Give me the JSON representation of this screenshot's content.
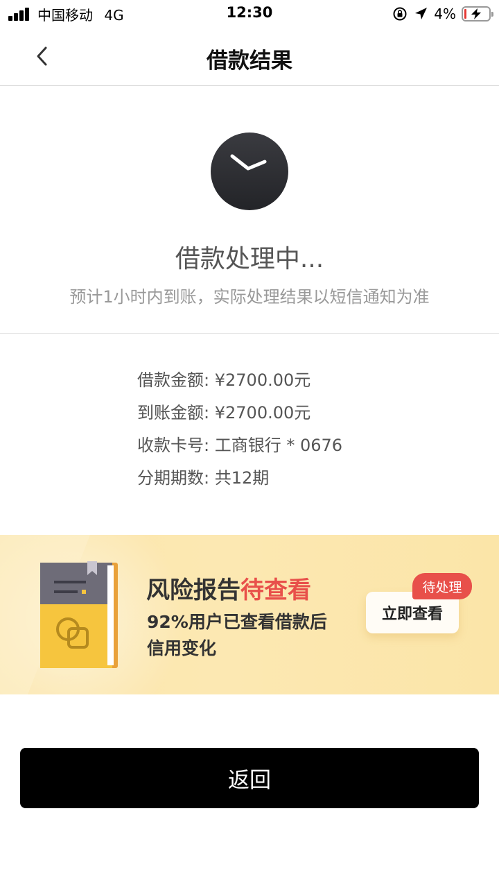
{
  "status_bar": {
    "carrier": "中国移动",
    "network": "4G",
    "time": "12:30",
    "battery_percent": "4%"
  },
  "nav": {
    "title": "借款结果"
  },
  "processing": {
    "title": "借款处理中...",
    "subtitle": "预计1小时内到账，实际处理结果以短信通知为准"
  },
  "details": [
    {
      "label": "借款金额:",
      "value": "¥2700.00元"
    },
    {
      "label": "到账金额:",
      "value": "¥2700.00元"
    },
    {
      "label": "收款卡号:",
      "value": "工商银行 * 0676"
    },
    {
      "label": "分期期数:",
      "value": "共12期"
    }
  ],
  "banner": {
    "title_main": "风险报告",
    "title_highlight": "待查看",
    "desc_line1": "92%用户已查看借款后",
    "desc_line2": "信用变化",
    "button_label": "立即查看",
    "tag_label": "待处理"
  },
  "return_button": {
    "label": "返回"
  },
  "colors": {
    "accent_red": "#e8504a",
    "banner_bg": "#fbe6ad",
    "primary_button": "#000000",
    "clock_badge": "#2e2f33"
  }
}
